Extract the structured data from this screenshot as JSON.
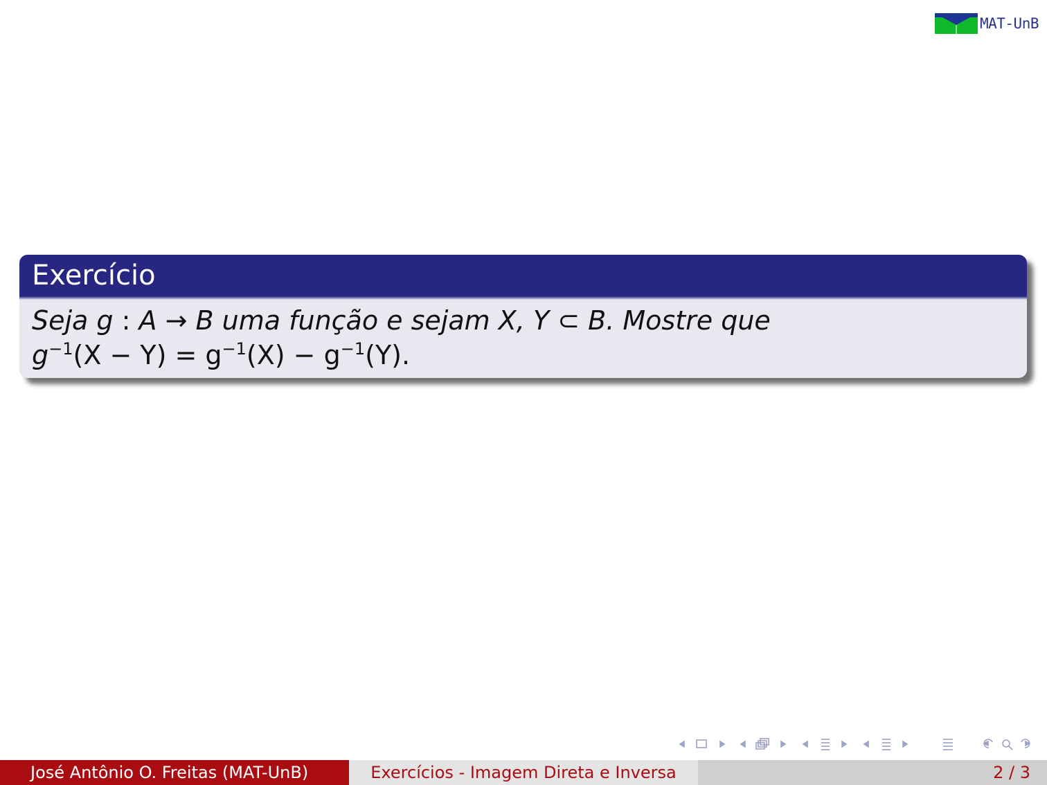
{
  "logo": {
    "text": "MAT-UnB",
    "colors": {
      "blue": "#1c3592",
      "green": "#10b82c"
    }
  },
  "block": {
    "title": "Exercício",
    "line1": {
      "intro": "Seja g",
      "colon": " : ",
      "mapping": "A → B",
      "middle": " uma função e sejam ",
      "sets": "X, Y ⊂ B.",
      "end": "  Mostre que"
    },
    "line2": {
      "g1": "g",
      "exp1": "−1",
      "arg1": "(X − Y) = g",
      "exp2": "−1",
      "arg2": "(X) − g",
      "exp3": "−1",
      "arg3": "(Y)."
    },
    "colors": {
      "header": "#272782",
      "body": "#e8e8f1"
    }
  },
  "navigation": {
    "icons": [
      "nav-left-arrow",
      "frame-icon",
      "nav-right-arrow",
      "nav-left-arrow",
      "subsection-icon",
      "nav-right-arrow",
      "nav-left-arrow",
      "section-icon",
      "nav-right-arrow",
      "nav-left-arrow",
      "section-icon",
      "nav-right-arrow",
      "document-icon",
      "back-icon",
      "search-icon",
      "forward-icon"
    ],
    "color": "#9ea2c6"
  },
  "footer": {
    "author": "José Antônio O. Freitas  (MAT-UnB)",
    "title": "Exercícios - Imagem Direta e Inversa",
    "page": "2 / 3",
    "colors": {
      "author_bg": "#aa0d11",
      "title_bg": "#e4e4e4",
      "page_bg": "#cfcfcf"
    }
  }
}
